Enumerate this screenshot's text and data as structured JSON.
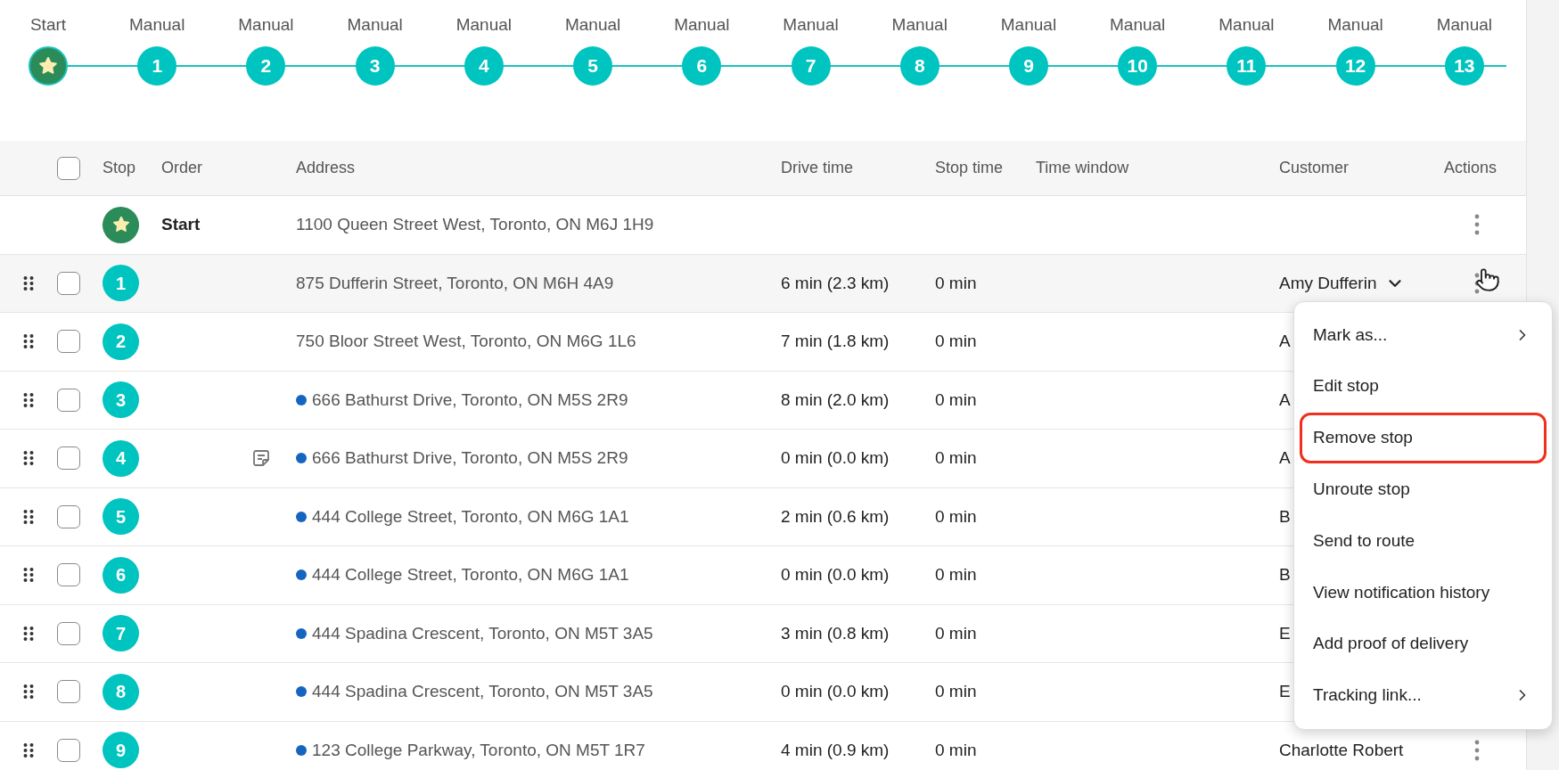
{
  "timeline": [
    {
      "kind": "start",
      "label": "Start"
    },
    {
      "kind": "stop",
      "label": "Manual",
      "number": "1"
    },
    {
      "kind": "stop",
      "label": "Manual",
      "number": "2"
    },
    {
      "kind": "stop",
      "label": "Manual",
      "number": "3"
    },
    {
      "kind": "stop",
      "label": "Manual",
      "number": "4"
    },
    {
      "kind": "stop",
      "label": "Manual",
      "number": "5"
    },
    {
      "kind": "stop",
      "label": "Manual",
      "number": "6"
    },
    {
      "kind": "stop",
      "label": "Manual",
      "number": "7"
    },
    {
      "kind": "stop",
      "label": "Manual",
      "number": "8"
    },
    {
      "kind": "stop",
      "label": "Manual",
      "number": "9"
    },
    {
      "kind": "stop",
      "label": "Manual",
      "number": "10"
    },
    {
      "kind": "stop",
      "label": "Manual",
      "number": "11"
    },
    {
      "kind": "stop",
      "label": "Manual",
      "number": "12"
    },
    {
      "kind": "stop",
      "label": "Manual",
      "number": "13"
    }
  ],
  "table": {
    "select_all": {
      "checked": false
    },
    "columns": [
      "Stop",
      "Order",
      "Address",
      "Drive time",
      "Stop time",
      "Time window",
      "Customer",
      "Actions"
    ],
    "rows": [
      {
        "kind": "start",
        "order": "Start",
        "address": "1100 Queen Street West, Toronto, ON M6J 1H9",
        "actions_icon": true
      },
      {
        "kind": "stop",
        "stop": "1",
        "checked": false,
        "hovered": true,
        "note": false,
        "dot": false,
        "address": "875 Dufferin Street, Toronto, ON M6H 4A9",
        "drive_time": "6 min (2.3 km)",
        "stop_time": "0 min",
        "customer": "Amy Dufferin",
        "actions_icon": true
      },
      {
        "kind": "stop",
        "stop": "2",
        "checked": false,
        "hovered": false,
        "note": false,
        "dot": false,
        "address": "750 Bloor Street West, Toronto, ON M6G 1L6",
        "drive_time": "7 min (1.8 km)",
        "stop_time": "0 min",
        "customer": "A",
        "actions_icon": false
      },
      {
        "kind": "stop",
        "stop": "3",
        "checked": false,
        "hovered": false,
        "note": false,
        "dot": true,
        "address": "666 Bathurst Drive, Toronto, ON M5S 2R9",
        "drive_time": "8 min (2.0 km)",
        "stop_time": "0 min",
        "customer": "A",
        "actions_icon": false
      },
      {
        "kind": "stop",
        "stop": "4",
        "checked": false,
        "hovered": false,
        "note": true,
        "dot": true,
        "address": "666 Bathurst Drive, Toronto, ON M5S 2R9",
        "drive_time": "0 min (0.0 km)",
        "stop_time": "0 min",
        "customer": "A",
        "actions_icon": false
      },
      {
        "kind": "stop",
        "stop": "5",
        "checked": false,
        "hovered": false,
        "note": false,
        "dot": true,
        "address": "444 College Street, Toronto, ON M6G 1A1",
        "drive_time": "2 min (0.6 km)",
        "stop_time": "0 min",
        "customer": "B",
        "actions_icon": false
      },
      {
        "kind": "stop",
        "stop": "6",
        "checked": false,
        "hovered": false,
        "note": false,
        "dot": true,
        "address": "444 College Street, Toronto, ON M6G 1A1",
        "drive_time": "0 min (0.0 km)",
        "stop_time": "0 min",
        "customer": "B",
        "actions_icon": false
      },
      {
        "kind": "stop",
        "stop": "7",
        "checked": false,
        "hovered": false,
        "note": false,
        "dot": true,
        "address": "444 Spadina Crescent, Toronto, ON M5T 3A5",
        "drive_time": "3 min (0.8 km)",
        "stop_time": "0 min",
        "customer": "E",
        "actions_icon": false
      },
      {
        "kind": "stop",
        "stop": "8",
        "checked": false,
        "hovered": false,
        "note": false,
        "dot": true,
        "address": "444 Spadina Crescent, Toronto, ON M5T 3A5",
        "drive_time": "0 min (0.0 km)",
        "stop_time": "0 min",
        "customer": "E",
        "actions_icon": false
      },
      {
        "kind": "stop",
        "stop": "9",
        "checked": false,
        "hovered": false,
        "note": false,
        "dot": true,
        "address": "123 College Parkway, Toronto, ON M5T 1R7",
        "drive_time": "4 min (0.9 km)",
        "stop_time": "0 min",
        "customer": "Charlotte Robert",
        "actions_icon": true
      }
    ]
  },
  "actions_menu": {
    "items": [
      {
        "label": "Mark as...",
        "submenu": true,
        "highlighted": false
      },
      {
        "label": "Edit stop",
        "submenu": false,
        "highlighted": false
      },
      {
        "label": "Remove stop",
        "submenu": false,
        "highlighted": true
      },
      {
        "label": "Unroute stop",
        "submenu": false,
        "highlighted": false
      },
      {
        "label": "Send to route",
        "submenu": false,
        "highlighted": false
      },
      {
        "label": "View notification history",
        "submenu": false,
        "highlighted": false
      },
      {
        "label": "Add proof of delivery",
        "submenu": false,
        "highlighted": false
      },
      {
        "label": "Tracking link...",
        "submenu": true,
        "highlighted": false
      }
    ]
  }
}
